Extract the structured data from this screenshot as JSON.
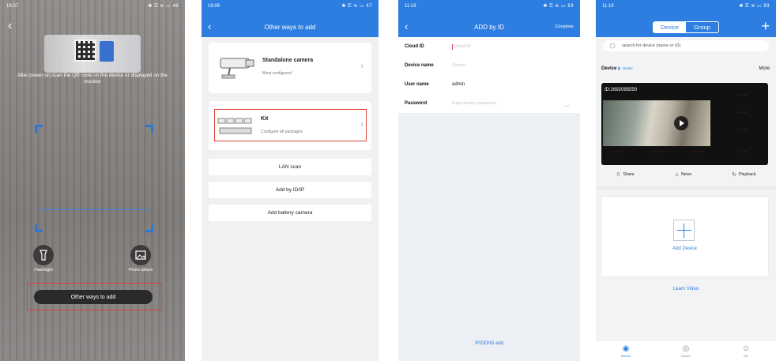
{
  "colors": {
    "accent": "#2d7ee0",
    "highlight_box": "#e0403a",
    "scanner_corner": "#2d78d6"
  },
  "screen1": {
    "status": {
      "time": "19:07",
      "battery": "46"
    },
    "scan_hint": "After power on,scan the QR code on the device or displayed on the monitor",
    "flashlight_label": "Flashlight",
    "photo_album_label": "Photo album",
    "other_ways_button": "Other ways to add"
  },
  "screen2": {
    "status": {
      "time": "19:09",
      "battery": "47"
    },
    "title": "Other ways to add",
    "options": [
      {
        "title": "Standalone camera",
        "subtitle": "Most configured"
      },
      {
        "title": "Kit",
        "subtitle": "Configure all packages"
      }
    ],
    "buttons": [
      "LAN scan",
      "Add by ID/IP",
      "Add battery camera"
    ]
  },
  "screen3": {
    "status": {
      "time": "11:18",
      "battery": "83"
    },
    "title": "ADD by ID",
    "complete_label": "Complete",
    "fields": [
      {
        "label": "Cloud ID",
        "value": "",
        "placeholder": "Cloud ID"
      },
      {
        "label": "Device name",
        "value": "",
        "placeholder": "Device"
      },
      {
        "label": "User name",
        "value": "admin",
        "placeholder": ""
      },
      {
        "label": "Password",
        "value": "",
        "placeholder": "Input device password"
      }
    ],
    "ip_ddns_link": "IP/DDNS add"
  },
  "screen4": {
    "status": {
      "time": "11:19",
      "battery": "83"
    },
    "segments": [
      "Device",
      "Group"
    ],
    "search_placeholder": "search for device (name or ID)",
    "device_label": "Device",
    "online_label": "Online",
    "more_label": "More",
    "video_id": "ID:2692095550",
    "actions": [
      "Share",
      "News",
      "Playback"
    ],
    "add_device_label": "Add Device",
    "learn_video_label": "Learn Video",
    "tabs": [
      "Device",
      "Discov",
      "Me"
    ]
  }
}
